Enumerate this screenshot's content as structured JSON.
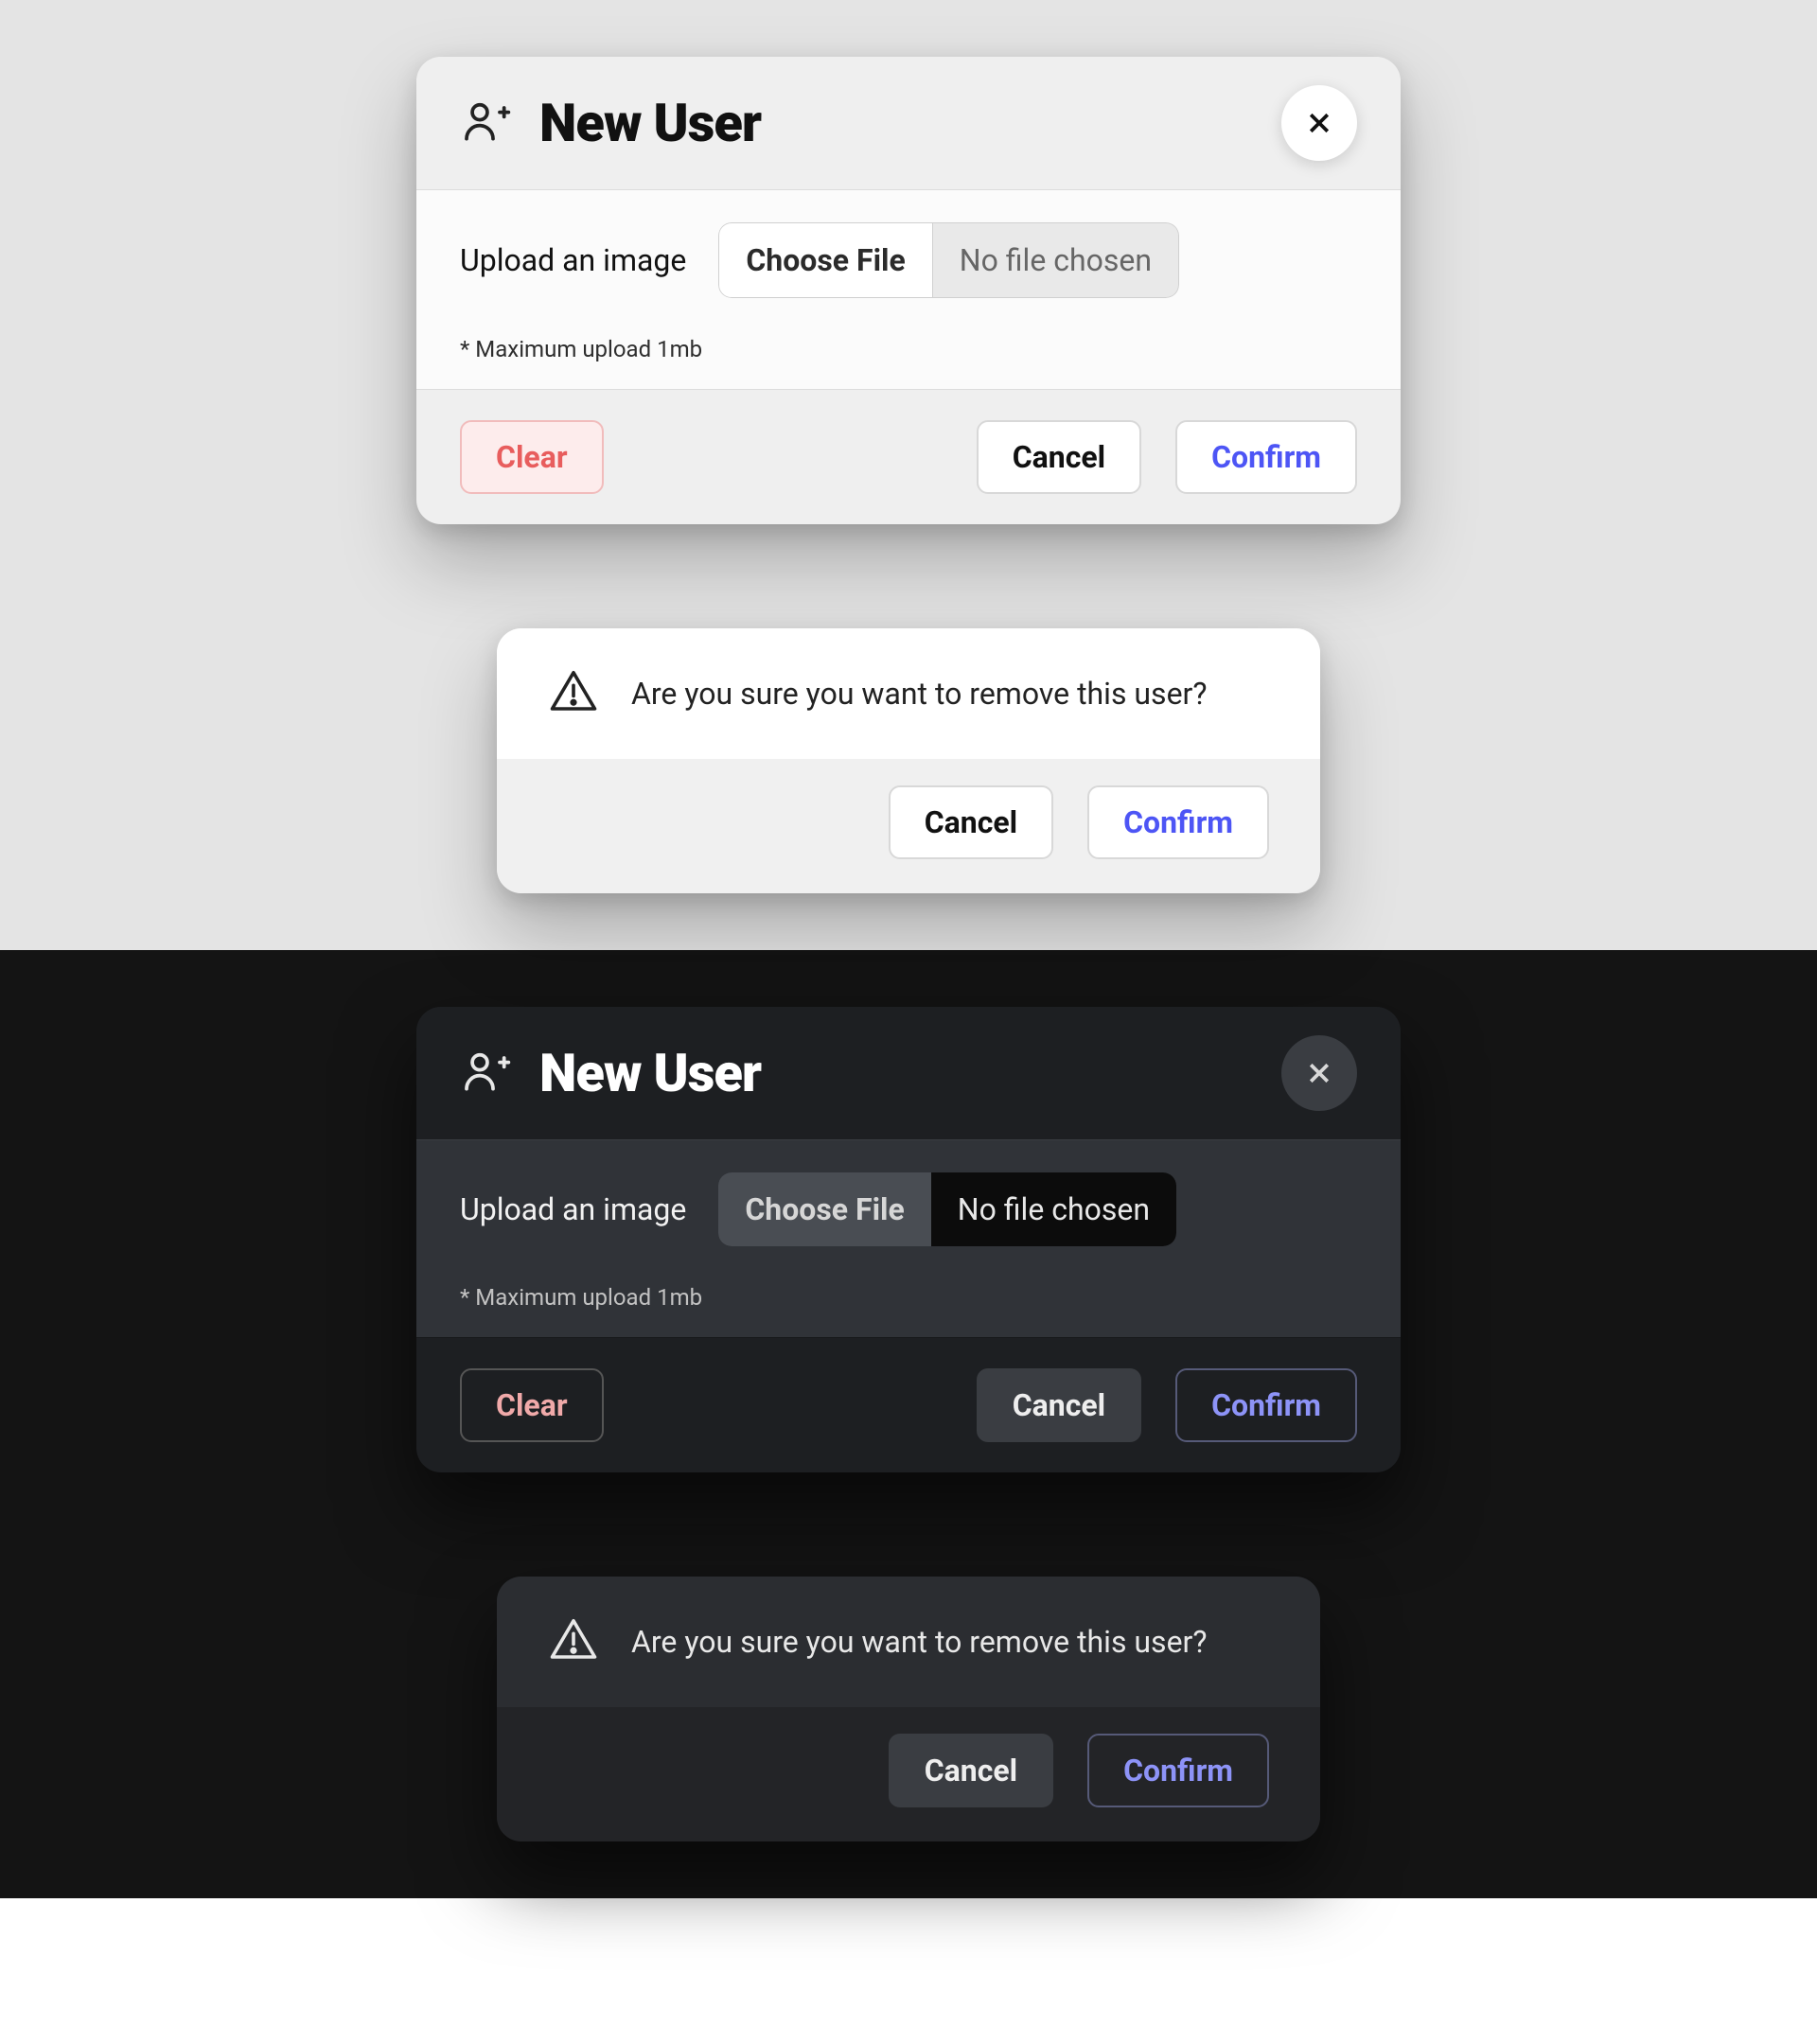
{
  "newUser": {
    "title": "New User",
    "uploadLabel": "Upload an image",
    "chooseFile": "Choose File",
    "fileStatus": "No file chosen",
    "hint": "* Maximum upload 1mb",
    "clear": "Clear",
    "cancel": "Cancel",
    "confirm": "Confirm"
  },
  "removeUser": {
    "message": "Are you sure you want to remove this user?",
    "cancel": "Cancel",
    "confirm": "Confirm"
  },
  "colors": {
    "accent": "#4d55f5",
    "danger": "#e85d5d",
    "lightBg": "#e4e4e4",
    "darkBg": "#141414"
  }
}
